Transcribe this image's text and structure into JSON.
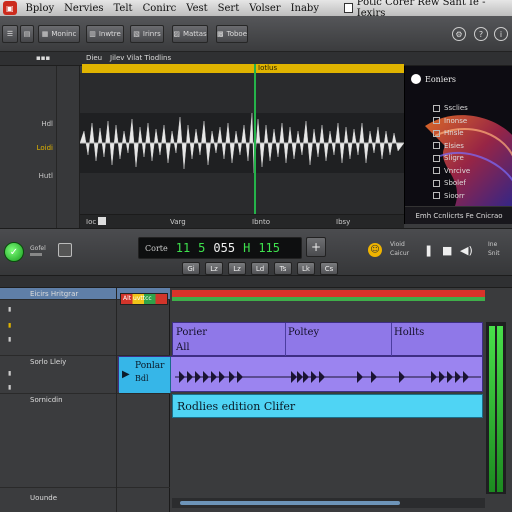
{
  "menubar": {
    "items": [
      "Bploy",
      "Nervies",
      "Telt",
      "Conirc",
      "Vest",
      "Sert",
      "Volser",
      "Inaby"
    ],
    "doc_title": "Potic Corer Rew Sant Ie - Iexirs"
  },
  "toolbar": {
    "buttons": [
      "Moninc",
      "Inwtre",
      "Irinrs",
      "Mattas",
      "Toboe"
    ]
  },
  "editor": {
    "ruler_labels": [
      "Dieu",
      "Jilev Vilat Tiodlins"
    ],
    "region_label": "Iotlus",
    "side_labels": [
      "Hdl",
      "Loidi",
      "Hutl"
    ],
    "foot_labels": [
      "Ioc",
      "Varg",
      "Ibnto",
      "Ibsy"
    ]
  },
  "right_panel": {
    "title": "Eoniers",
    "items": [
      "Ssclies",
      "Inonse",
      "Hnsle",
      "Elsies",
      "Sligre",
      "Vnrcive",
      "Sbolef",
      "Sioorr"
    ],
    "footer": "Emh Ccnlicrts Fe Cnicrao"
  },
  "transport": {
    "go_label": "Gofel",
    "lcd_label": "Corte",
    "bars": "11",
    "beats": "5",
    "division": "055",
    "ticks": "H",
    "tempo": "115",
    "add": "+",
    "mode_buttons": [
      "Gi",
      "Lz",
      "Lz",
      "Ld",
      "Ts",
      "Lk",
      "Cs"
    ],
    "voice_label": "Vioid",
    "voice_sub": "Caicur",
    "tune_label": "Ine",
    "tune_sub": "Snit"
  },
  "tracks": {
    "headers": [
      {
        "name": "Eicirs Hritgrar",
        "selected": true
      },
      {
        "name": "Sorlo Lleiy",
        "selected": false
      },
      {
        "name": "Sornicdin",
        "selected": false
      },
      {
        "name": "Uounde",
        "selected": false
      }
    ],
    "color_strip_label": "Alt uvttcc",
    "purple_segments": [
      "Porier",
      "Poltey",
      "Hollts"
    ],
    "purple_sub": "All",
    "midi_title": "Ponlar",
    "midi_sub": "Bdl",
    "cyan_label": "Rodlies edition Clifer"
  },
  "colors": {
    "accent_green": "#3ee04d",
    "playhead": "#25b24a",
    "region_purple": "#8f78e8",
    "region_cyan": "#4fd4f4",
    "marker_yellow": "#e0b400",
    "timeline_red": "#d9332a"
  }
}
